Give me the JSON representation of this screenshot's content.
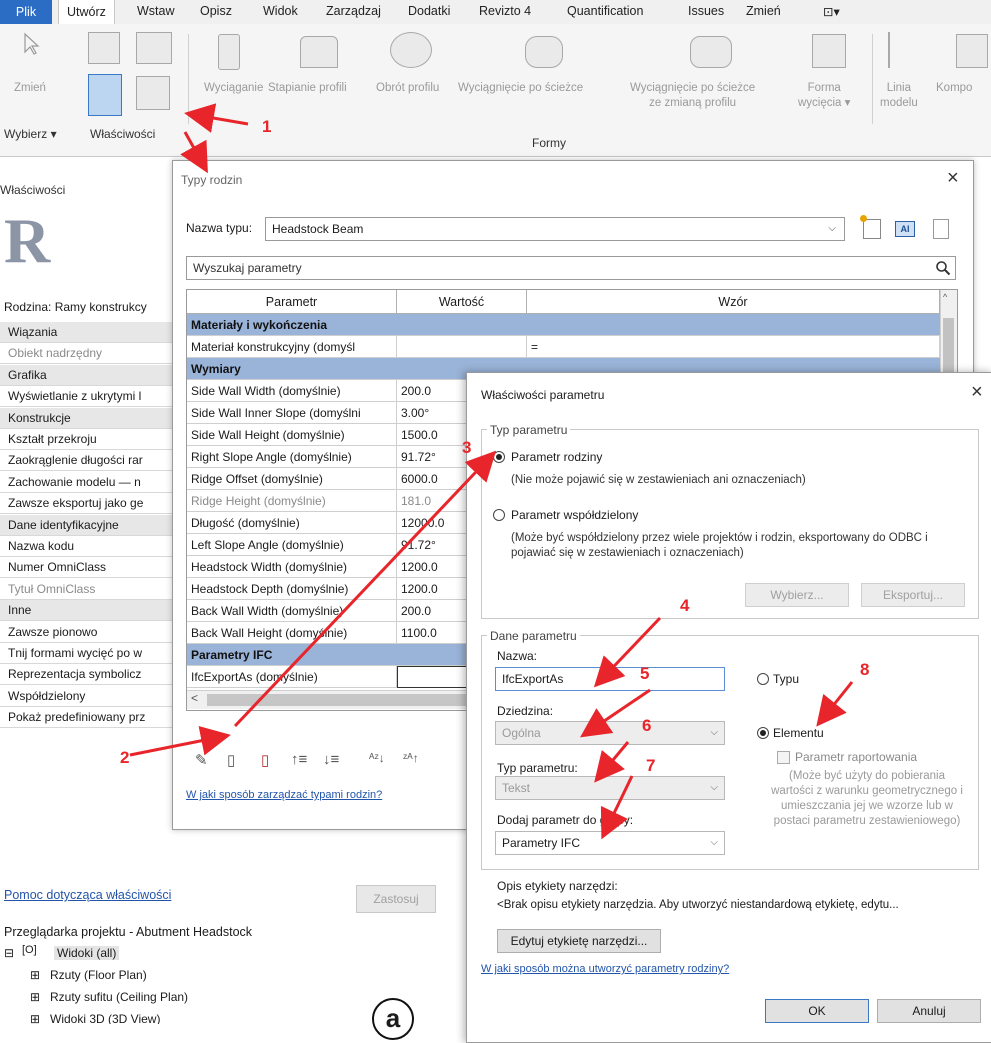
{
  "menu": [
    "Plik",
    "Utwórz",
    "Wstaw",
    "Opisz",
    "Widok",
    "Zarządzaj",
    "Dodatki",
    "Revizto 4",
    "Quantification",
    "Issues",
    "Zmień",
    "⊡▾"
  ],
  "ribbon": {
    "modify_label": "Zmień",
    "select_label": "Wybierz ▾",
    "properties_label": "Właściwości",
    "forms_label": "Formy",
    "tools": [
      "Wyciąganie",
      "Stapianie profili",
      "Obrót profilu",
      "Wyciągnięcie po ścieżce",
      "Wyciągnięcie po ścieżce\nze zmianą profilu",
      "Forma\nwycięcia ▾",
      "Linia\nmodelu",
      "Kompo"
    ]
  },
  "properties_panel": {
    "title": "Właściwości",
    "family": "Rodzina: Ramy konstrukcy",
    "rows": [
      {
        "text": "Wiązania",
        "kind": "cat"
      },
      {
        "text": "Obiekt nadrzędny",
        "kind": "gray"
      },
      {
        "text": "Grafika",
        "kind": "cat"
      },
      {
        "text": "Wyświetlanie z ukrytymi l",
        "kind": ""
      },
      {
        "text": "Konstrukcje",
        "kind": "cat"
      },
      {
        "text": "Kształt przekroju",
        "kind": ""
      },
      {
        "text": "Zaokrąglenie długości rar",
        "kind": ""
      },
      {
        "text": "Zachowanie modelu — n",
        "kind": ""
      },
      {
        "text": "Zawsze eksportuj jako ge",
        "kind": ""
      },
      {
        "text": "Dane identyfikacyjne",
        "kind": "cat"
      },
      {
        "text": "Nazwa kodu",
        "kind": ""
      },
      {
        "text": "Numer OmniClass",
        "kind": ""
      },
      {
        "text": "Tytuł OmniClass",
        "kind": "gray"
      },
      {
        "text": "Inne",
        "kind": "cat"
      },
      {
        "text": "Zawsze pionowo",
        "kind": ""
      },
      {
        "text": "Tnij formami wycięć po w",
        "kind": ""
      },
      {
        "text": "Reprezentacja symbolicz",
        "kind": ""
      },
      {
        "text": "Współdzielony",
        "kind": ""
      },
      {
        "text": "Pokaż predefiniowany prz",
        "kind": ""
      }
    ],
    "help_link": "Pomoc dotycząca właściwości",
    "apply": "Zastosuj"
  },
  "project_browser": {
    "title": "Przeglądarka projektu - Abutment Headstock",
    "views": "Widoki (all)",
    "items": [
      "Rzuty (Floor Plan)",
      "Rzuty sufitu (Ceiling Plan)",
      "Widoki 3D (3D View)"
    ]
  },
  "family_types": {
    "title": "Typy rodzin",
    "type_name_label": "Nazwa typu:",
    "type_name": "Headstock Beam",
    "search_placeholder": "Wyszukaj parametry",
    "columns": [
      "Parametr",
      "Wartość",
      "Wzór"
    ],
    "groups": [
      {
        "name": "Materiały i wykończenia",
        "rows": [
          {
            "p": "Materiał konstrukcyjny (domyśl",
            "v": "",
            "f": "=",
            "gray": false
          }
        ]
      },
      {
        "name": "Wymiary",
        "rows": [
          {
            "p": "Side Wall Width (domyślnie)",
            "v": "200.0",
            "f": "",
            "gray": false
          },
          {
            "p": "Side Wall Inner Slope (domyślni",
            "v": "3.00°",
            "f": "",
            "gray": false
          },
          {
            "p": "Side Wall Height (domyślnie)",
            "v": "1500.0",
            "f": "",
            "gray": false
          },
          {
            "p": "Right Slope Angle (domyślnie)",
            "v": "91.72°",
            "f": "",
            "gray": false
          },
          {
            "p": "Ridge Offset (domyślnie)",
            "v": "6000.0",
            "f": "",
            "gray": false
          },
          {
            "p": "Ridge Height (domyślnie)",
            "v": "181.0",
            "f": "",
            "gray": true
          },
          {
            "p": "Długość (domyślnie)",
            "v": "12000.0",
            "f": "",
            "gray": false
          },
          {
            "p": "Left Slope Angle (domyślnie)",
            "v": "91.72°",
            "f": "",
            "gray": false
          },
          {
            "p": "Headstock Width (domyślnie)",
            "v": "1200.0",
            "f": "",
            "gray": false
          },
          {
            "p": "Headstock Depth (domyślnie)",
            "v": "1200.0",
            "f": "",
            "gray": false
          },
          {
            "p": "Back Wall Width (domyślnie)",
            "v": "200.0",
            "f": "",
            "gray": false
          },
          {
            "p": "Back Wall Height (domyślnie)",
            "v": "1100.0",
            "f": "",
            "gray": false
          }
        ]
      },
      {
        "name": "Parametry IFC",
        "rows": [
          {
            "p": "IfcExportAs (domyślnie)",
            "v": "",
            "f": "",
            "gray": false
          }
        ]
      }
    ],
    "help_link": "W jaki sposób zarządzać typami rodzin?"
  },
  "param_props": {
    "title": "Właściwości parametru",
    "type_group": "Typ parametru",
    "family_param": "Parametr rodziny",
    "family_param_desc": "(Nie może pojawić się w zestawieniach ani oznaczeniach)",
    "shared_param": "Parametr współdzielony",
    "shared_param_desc": "(Może być współdzielony przez wiele projektów i rodzin, eksportowany do ODBC i pojawiać się w zestawieniach i oznaczeniach)",
    "select_btn": "Wybierz...",
    "export_btn": "Eksportuj...",
    "data_group": "Dane parametru",
    "name_label": "Nazwa:",
    "name_value": "IfcExportAs",
    "discipline_label": "Dziedzina:",
    "discipline_value": "Ogólna",
    "ptype_label": "Typ parametru:",
    "ptype_value": "Tekst",
    "group_label": "Dodaj parametr do grupy:",
    "group_value": "Parametry IFC",
    "type_radio": "Typu",
    "instance_radio": "Elementu",
    "reporting": "Parametr raportowania",
    "reporting_desc": "(Może być użyty do pobierania wartości z warunku geometrycznego i umieszczania jej we wzorze lub w postaci parametru zestawieniowego)",
    "tooltip_label": "Opis etykiety narzędzi:",
    "tooltip_value": "<Brak opisu etykiety narzędzia. Aby utworzyć niestandardową etykietę, edytu...",
    "edit_tooltip_btn": "Edytuj etykietę narzędzi...",
    "help_link": "W jaki sposób można utworzyć parametry rodziny?",
    "ok": "OK",
    "cancel": "Anuluj"
  },
  "annotations": [
    "1",
    "2",
    "3",
    "4",
    "5",
    "6",
    "7",
    "8"
  ],
  "figure_label": "a",
  "colors": {
    "accent": "#2b6cc4",
    "group_row": "#9ab3d8",
    "annotation": "#e8252a"
  }
}
